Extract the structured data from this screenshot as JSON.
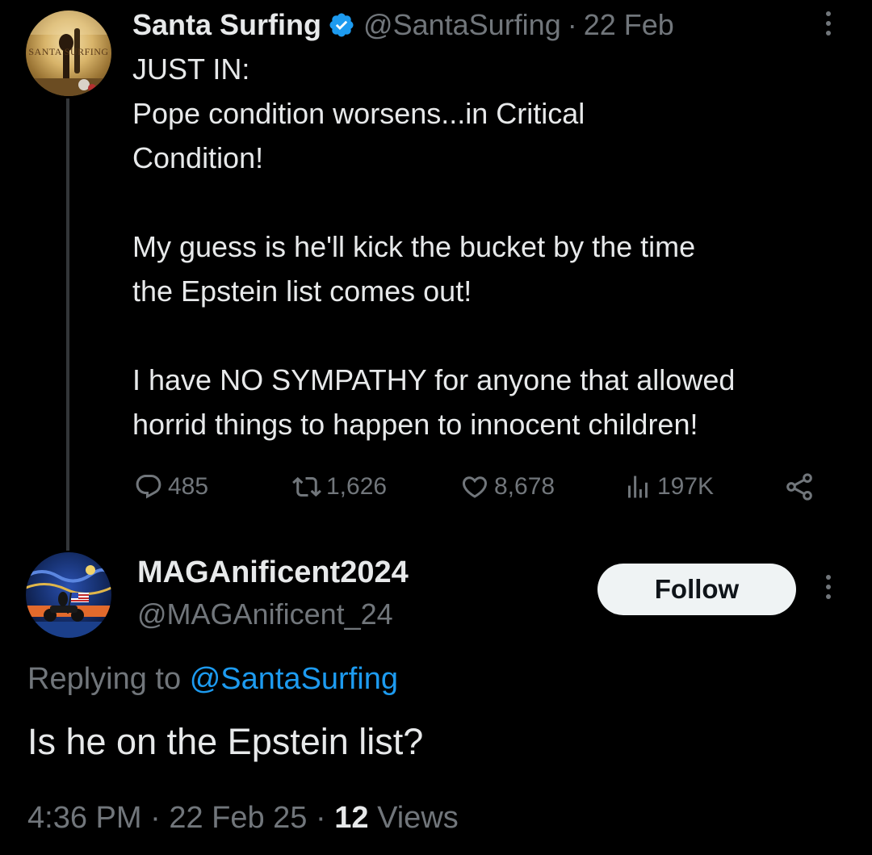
{
  "tweet": {
    "author": {
      "name": "Santa Surfing",
      "handle": "@SantaSurfing",
      "avatar_logo_text": "SANTA SURFING"
    },
    "separator": "·",
    "date": "22 Feb",
    "text": "JUST IN:\nPope condition worsens...in Critical\nCondition!\n\nMy guess is he'll kick the bucket by the time\nthe Epstein list comes out!\n\nI have NO SYMPATHY for anyone that allowed\nhorrid things to happen to innocent children!",
    "stats": {
      "replies": "485",
      "reposts": "1,626",
      "likes": "8,678",
      "views": "197K"
    }
  },
  "reply": {
    "author": {
      "name": "MAGAnificent2024",
      "handle": "@MAGAnificent_24"
    },
    "follow_label": "Follow",
    "replying_prefix": "Replying to",
    "replying_to": "@SantaSurfing",
    "text": "Is he on the Epstein list?",
    "meta": {
      "time": "4:36 PM",
      "sep1": "·",
      "date": "22 Feb 25",
      "sep2": "·",
      "views_count": "12",
      "views_label": "Views"
    }
  },
  "colors": {
    "background": "#000000",
    "primary_text": "#e7e9ea",
    "secondary_text": "#71767b",
    "link": "#1d9bf0",
    "verified": "#1d9bf0",
    "follow_button_bg": "#eff3f4"
  },
  "icons": {
    "verified": "verified-badge-icon",
    "reply": "reply-bubble-icon",
    "repost": "repost-icon",
    "like": "heart-icon",
    "views": "analytics-bars-icon",
    "share": "share-icon",
    "more": "more-vertical-icon"
  }
}
